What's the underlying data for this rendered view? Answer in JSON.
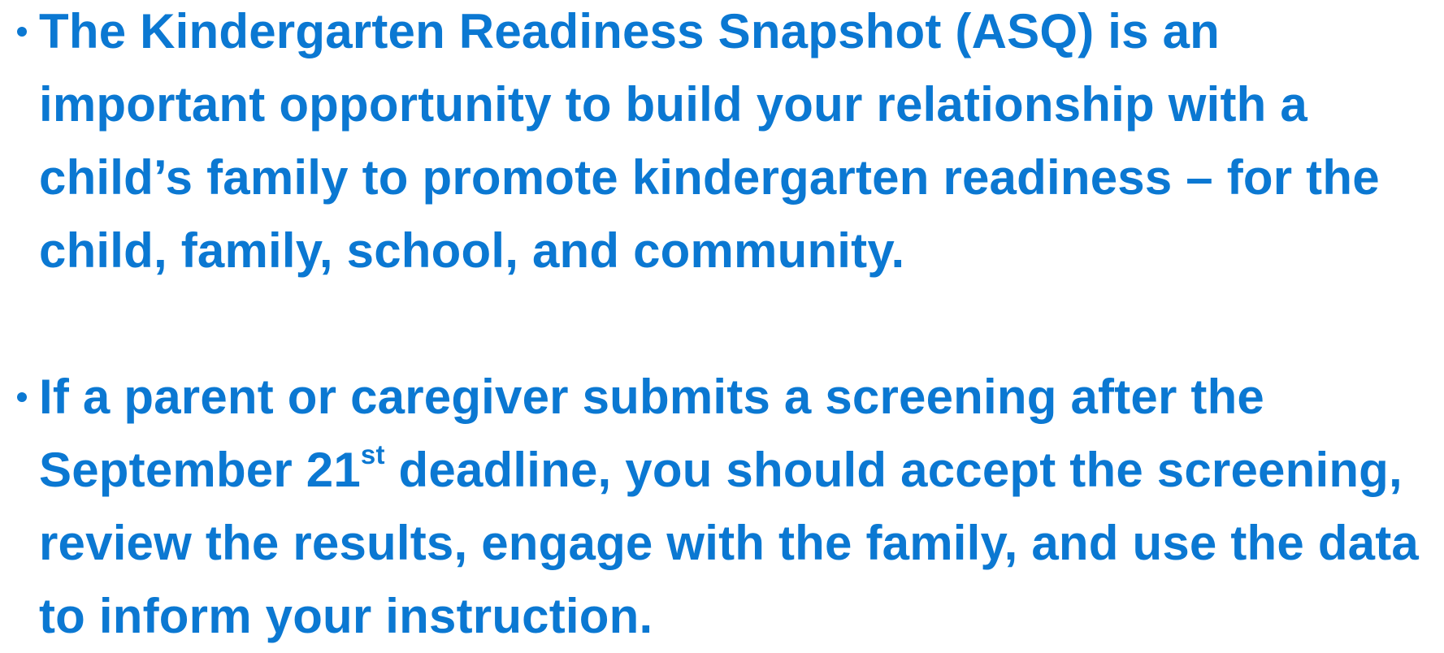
{
  "bullets": [
    {
      "text": "The Kindergarten Readiness Snapshot (ASQ) is an important opportunity to build your relationship with a child’s family to promote kindergarten readiness – for the child, family, school, and community."
    },
    {
      "text_before": "If a parent or caregiver submits a screening after the September 21",
      "superscript": "st",
      "text_after": " deadline, you should accept the screening, review the results, engage with the family, and use the data to inform your instruction."
    }
  ],
  "colors": {
    "text": "#0b78d2",
    "background": "#ffffff"
  }
}
